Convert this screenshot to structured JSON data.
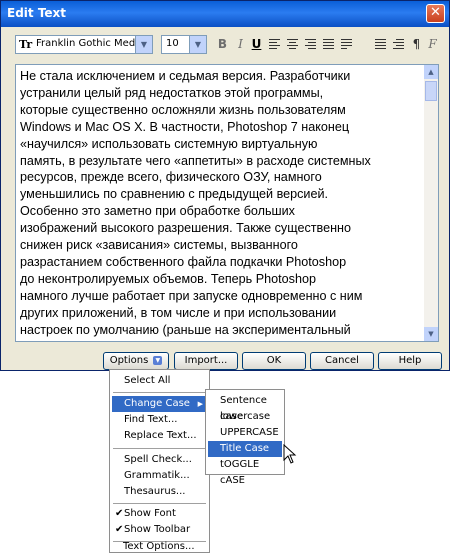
{
  "window": {
    "title": "Edit Text",
    "close_glyph": "✕"
  },
  "toolbar": {
    "font_glyph": "Tr",
    "font_name": "Franklin Gothic Medium",
    "font_size": "10",
    "bold_label": "B",
    "italic_label": "I",
    "underline_label": "U",
    "pilcrow": "¶",
    "f_label": "F"
  },
  "text_lines": [
    "Не стала исключением и седьмая версия. Разработчики",
    "устранили целый ряд недостатков этой программы,",
    "которые существенно осложняли жизнь пользователям",
    "Windows и Mac OS X. В частности, Photoshop 7 наконец",
    "«научился» использовать системную виртуальную",
    "память, в результате чего «аппетиты» в расходе системных",
    "ресурсов, прежде всего, физического ОЗУ, намного",
    "уменьшились по сравнению с предыдущей версией.",
    "Особенно это заметно при обработке больших",
    "изображений высокого разрешения. Также существенно",
    "снижен риск «зависания» системы, вызванного",
    "разрастанием собственного файла подкачки Photoshop",
    "до неконтролируемых объемов. Теперь Photoshop",
    "намного лучше работает при запуске одновременно с ним",
    "других приложений, в том числе и при использовании",
    "настроек по умолчанию (раньше на экспериментальный"
  ],
  "buttons": {
    "options": "Options",
    "import": "Import...",
    "ok": "OK",
    "cancel": "Cancel",
    "help": "Help"
  },
  "options_menu": {
    "select_all": "Select All",
    "change_case": "Change Case",
    "find_text": "Find Text...",
    "replace_text": "Replace Text...",
    "spell_check": "Spell Check...",
    "grammatik": "Grammatik...",
    "thesaurus": "Thesaurus...",
    "show_font": "Show Font",
    "show_toolbar": "Show Toolbar",
    "text_options": "Text Options..."
  },
  "case_menu": {
    "sentence": "Sentence case",
    "lower": "lowercase",
    "upper": "UPPERCASE",
    "title": "Title Case",
    "toggle": "tOGGLE cASE"
  },
  "colors": {
    "highlight": "#316ac5",
    "titlebar": "#0a5fd8"
  }
}
